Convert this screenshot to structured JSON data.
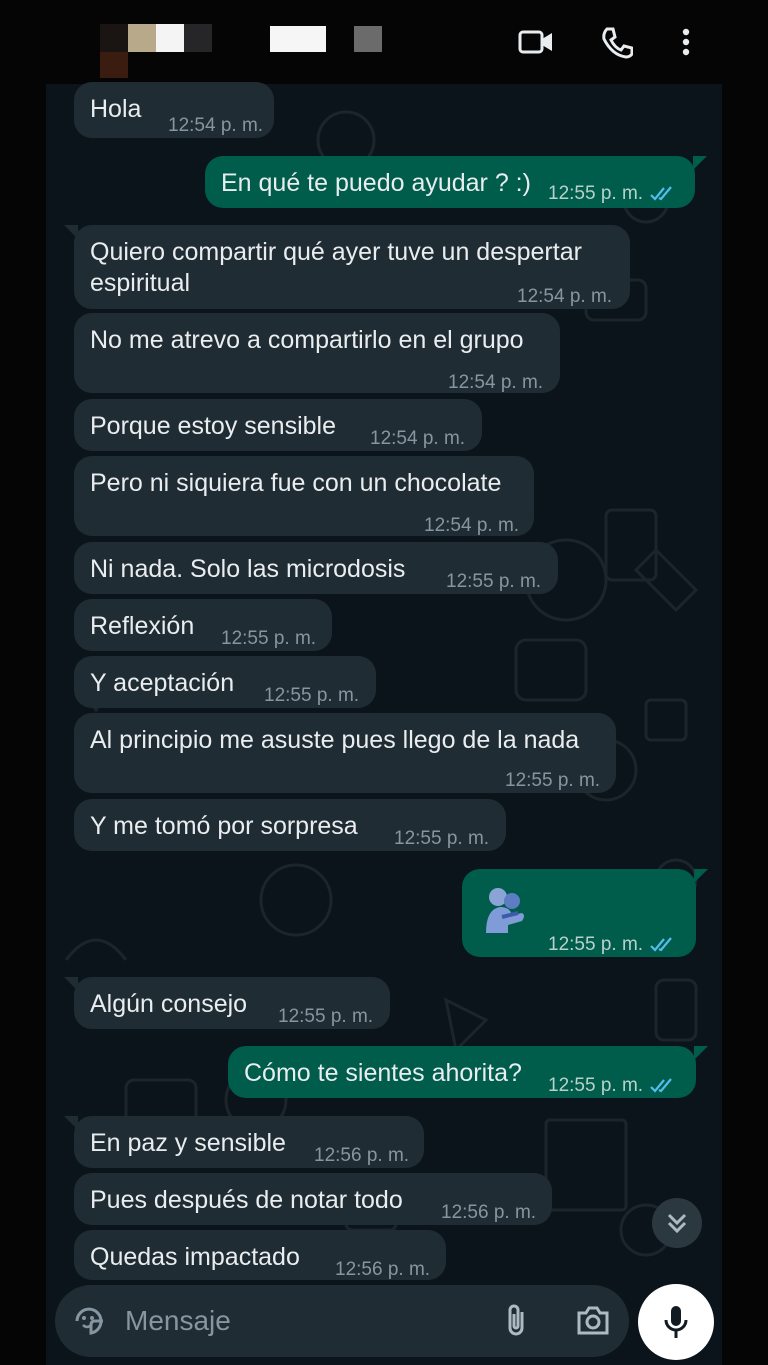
{
  "header": {
    "video_call_icon": "video-icon",
    "voice_call_icon": "phone-icon",
    "menu_icon": "more-vertical-icon"
  },
  "messages": [
    {
      "dir": "in",
      "text": "Hola",
      "time": "12:54 p. m."
    },
    {
      "dir": "out",
      "text": "En qué te puedo ayudar ? :)",
      "time": "12:55 p. m.",
      "read": true
    },
    {
      "dir": "in",
      "text": "Quiero compartir qué ayer tuve un despertar espiritual",
      "time": "12:54 p. m."
    },
    {
      "dir": "in",
      "text": "No me atrevo a compartirlo en el grupo",
      "time": "12:54 p. m."
    },
    {
      "dir": "in",
      "text": "Porque estoy sensible",
      "time": "12:54 p. m."
    },
    {
      "dir": "in",
      "text": "Pero ni siquiera fue con un chocolate",
      "time": "12:54 p. m."
    },
    {
      "dir": "in",
      "text": "Ni nada. Solo las microdosis",
      "time": "12:55 p. m."
    },
    {
      "dir": "in",
      "text": "Reflexión",
      "time": "12:55 p. m."
    },
    {
      "dir": "in",
      "text": "Y aceptación",
      "time": "12:55 p. m."
    },
    {
      "dir": "in",
      "text": "Al principio me asuste pues llego de la nada",
      "time": "12:55 p. m."
    },
    {
      "dir": "in",
      "text": "Y me tomó por sorpresa",
      "time": "12:55 p. m."
    },
    {
      "dir": "out",
      "text": "",
      "sticker": "hug-emoji",
      "time": "12:55 p. m.",
      "read": true
    },
    {
      "dir": "in",
      "text": "Algún consejo",
      "time": "12:55 p. m."
    },
    {
      "dir": "out",
      "text": "Cómo te sientes ahorita?",
      "time": "12:55 p. m.",
      "read": true
    },
    {
      "dir": "in",
      "text": "En paz y sensible",
      "time": "12:56 p. m."
    },
    {
      "dir": "in",
      "text": "Pues después de notar todo",
      "time": "12:56 p. m."
    },
    {
      "dir": "in",
      "text": "Quedas impactado",
      "time": "12:56 p. m."
    }
  ],
  "composer": {
    "placeholder": "Mensaje",
    "emoji_icon": "sticker-icon",
    "attach_icon": "paperclip-icon",
    "camera_icon": "camera-icon",
    "mic_icon": "mic-icon"
  },
  "colors": {
    "incoming_bubble": "#202c33",
    "outgoing_bubble": "#005c4b",
    "read_ticks": "#53bdeb",
    "background": "#0b141a"
  }
}
